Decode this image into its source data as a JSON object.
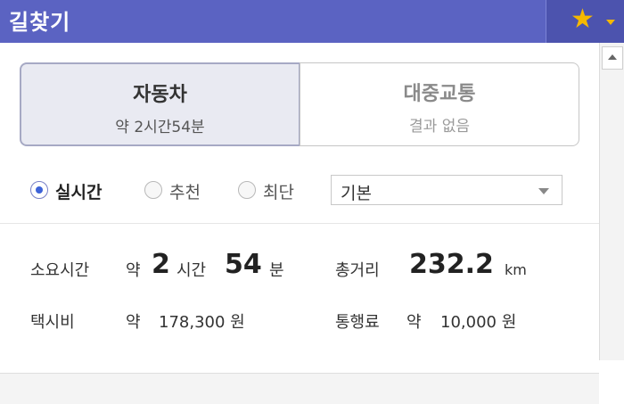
{
  "header": {
    "title": "길찾기",
    "favorite_icon": "star-icon",
    "star_color": "#f5b800"
  },
  "tabs": [
    {
      "label": "자동차",
      "sub": "약 2시간54분",
      "active": true
    },
    {
      "label": "대중교통",
      "sub": "결과 없음",
      "active": false
    }
  ],
  "route_options": [
    {
      "label": "실시간",
      "checked": true
    },
    {
      "label": "추천",
      "checked": false
    },
    {
      "label": "최단",
      "checked": false
    }
  ],
  "dropdown": {
    "selected": "기본"
  },
  "summary": {
    "time_label": "소요시간",
    "approx": "약",
    "hours": "2",
    "hours_unit": "시간",
    "minutes": "54",
    "minutes_unit": "분",
    "distance_label": "총거리",
    "distance": "232.2",
    "distance_unit": "km",
    "taxi_label": "택시비",
    "taxi_value": "178,300 원",
    "toll_label": "통행료",
    "toll_value": "10,000 원"
  },
  "colors": {
    "header_bg": "#5b63c2",
    "radio_accent": "#3d63d8"
  }
}
